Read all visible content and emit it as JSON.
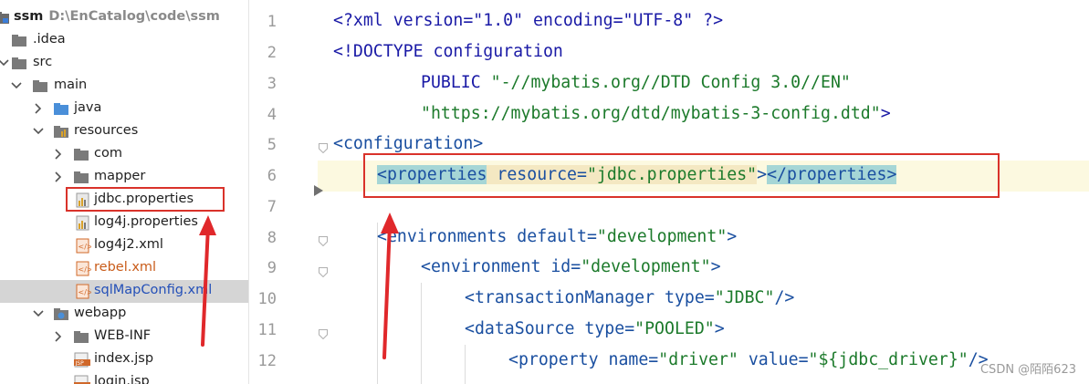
{
  "project_tree": {
    "items": [
      {
        "name": "tree-item-ssm",
        "label": "ssm",
        "sublabel": "D:\\EnCatalog\\code\\ssm"
      },
      {
        "name": "tree-item-idea",
        "label": ".idea"
      },
      {
        "name": "tree-item-src",
        "label": "src"
      },
      {
        "name": "tree-item-main",
        "label": "main"
      },
      {
        "name": "tree-item-java",
        "label": "java"
      },
      {
        "name": "tree-item-resources",
        "label": "resources"
      },
      {
        "name": "tree-item-com",
        "label": "com"
      },
      {
        "name": "tree-item-mapper",
        "label": "mapper"
      },
      {
        "name": "tree-item-jdbc-properties",
        "label": "jdbc.properties"
      },
      {
        "name": "tree-item-log4j-properties",
        "label": "log4j.properties"
      },
      {
        "name": "tree-item-log4j2-xml",
        "label": "log4j2.xml"
      },
      {
        "name": "tree-item-rebel-xml",
        "label": "rebel.xml"
      },
      {
        "name": "tree-item-sqlmapconfig-xml",
        "label": "sqlMapConfig.xml"
      },
      {
        "name": "tree-item-webapp",
        "label": "webapp"
      },
      {
        "name": "tree-item-web-inf",
        "label": "WEB-INF"
      },
      {
        "name": "tree-item-index-jsp",
        "label": "index.jsp"
      },
      {
        "name": "tree-item-login-jsp",
        "label": "login.jsp"
      }
    ]
  },
  "editor": {
    "line_numbers": [
      "1",
      "2",
      "3",
      "4",
      "5",
      "6",
      "7",
      "8",
      "9",
      "10",
      "11",
      "12"
    ],
    "line1": {
      "pi": "<?xml version=\"1.0\" encoding=\"UTF-8\" ?>"
    },
    "line2": {
      "open": "<!DOCTYPE ",
      "name": "configuration"
    },
    "line3": {
      "kw": "PUBLIC ",
      "str": "\"-//mybatis.org//DTD Config 3.0//EN\""
    },
    "line4": {
      "str": "\"https://mybatis.org/dtd/mybatis-3-config.dtd\"",
      "close": ">"
    },
    "line5": {
      "tag": "<configuration>"
    },
    "line6": {
      "tag_open": "<properties",
      "attr": " resource=",
      "val": "\"jdbc.properties\"",
      "gt": ">",
      "tag_close": "</properties",
      "end": ">"
    },
    "line8": {
      "tag": "<environments",
      "attr": " default=",
      "val": "\"development\"",
      "end": ">"
    },
    "line9": {
      "tag": "<environment",
      "attr": " id=",
      "val": "\"development\"",
      "end": ">"
    },
    "line10": {
      "tag": "<transactionManager",
      "attr": " type=",
      "val": "\"JDBC\"",
      "end": "/>"
    },
    "line11": {
      "tag": "<dataSource",
      "attr": " type=",
      "val": "\"POOLED\"",
      "end": ">"
    },
    "line12": {
      "tag": "<property",
      "attr1": " name=",
      "val1": "\"driver\"",
      "attr2": " value=",
      "val2": "\"${jdbc_driver}\"",
      "end": "/>"
    }
  },
  "watermark": "CSDN @陌陌623",
  "colors": {
    "annotation_red": "#d9322a",
    "selection": "#d5d5d5"
  }
}
